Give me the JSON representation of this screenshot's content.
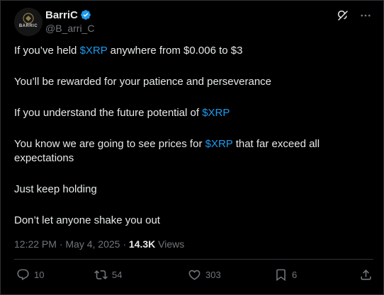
{
  "author": {
    "display_name": "BarriC",
    "handle": "@B_arri_C",
    "avatar_text": "BARRIC",
    "verified": true
  },
  "tweet": {
    "paragraphs": [
      [
        {
          "text": "If you’ve held "
        },
        {
          "text": "$XRP",
          "tag": true
        },
        {
          "text": " anywhere from $0.006 to $3"
        }
      ],
      [
        {
          "text": "You’ll be rewarded for your patience and perseverance"
        }
      ],
      [
        {
          "text": "If you understand the future potential of "
        },
        {
          "text": "$XRP",
          "tag": true
        }
      ],
      [
        {
          "text": "You know we are going to see prices for "
        },
        {
          "text": "$XRP",
          "tag": true
        },
        {
          "text": " that far exceed all expectations"
        }
      ],
      [
        {
          "text": "Just keep holding"
        }
      ],
      [
        {
          "text": "Don’t let anyone shake you out"
        }
      ]
    ]
  },
  "meta": {
    "time": "12:22 PM",
    "separator": " · ",
    "date": "May 4, 2025",
    "views_count": "14.3K",
    "views_label": "Views"
  },
  "actions": {
    "reply_count": "10",
    "retweet_count": "54",
    "like_count": "303",
    "bookmark_count": "6"
  },
  "colors": {
    "background": "#000000",
    "text": "#e7e9ea",
    "muted": "#71767b",
    "link": "#1d9bf0",
    "border": "#2f3336"
  },
  "icons": {
    "verified": "verified-badge-icon",
    "grok": "grok-icon",
    "more": "more-horizontal-icon",
    "reply": "reply-icon",
    "retweet": "retweet-icon",
    "like": "heart-icon",
    "bookmark": "bookmark-icon",
    "share": "share-icon"
  }
}
